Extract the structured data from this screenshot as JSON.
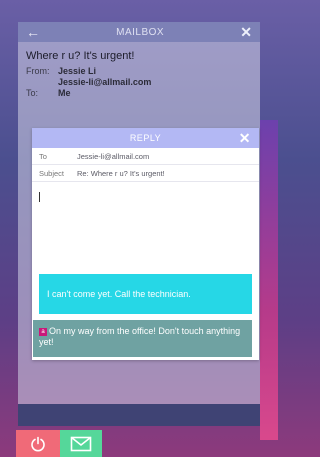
{
  "mailbox": {
    "title": "MAILBOX",
    "back_icon": "arrow-left-icon",
    "close_icon": "close-icon",
    "subject": "Where r u? It's urgent!",
    "from_label": "From:",
    "from_name": "Jessie Li",
    "from_email": "Jessie-li@allmail.com",
    "to_label": "To:",
    "to_value": "Me"
  },
  "reply": {
    "title": "REPLY",
    "close_icon": "close-icon",
    "to_label": "To",
    "to_value": "Jessie-li@allmail.com",
    "subject_label": "Subject",
    "subject_value": "Re: Where r u? It's urgent!"
  },
  "suggestions": [
    {
      "text": "I can't come yet. Call the technician."
    },
    {
      "badge": "a",
      "text": "On my way from the office! Don't touch anything yet!"
    }
  ],
  "bottom": {
    "power_icon": "power-icon",
    "mail_icon": "envelope-icon"
  },
  "colors": {
    "reply_bar": "#b3b8f4",
    "suggestion_cyan": "#26d7e6",
    "suggestion_teal": "#6fa2a2",
    "power": "#f06a78",
    "mail": "#55d79a"
  }
}
